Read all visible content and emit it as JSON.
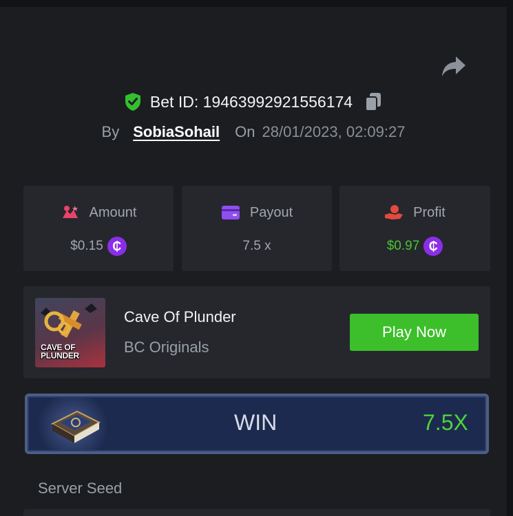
{
  "bet": {
    "label": "Bet ID:",
    "id": "19463992921556174",
    "by_label": "By",
    "user": "SobiaSohail",
    "on_label": "On",
    "datetime": "28/01/2023, 02:09:27"
  },
  "stats": {
    "amount": {
      "label": "Amount",
      "value": "$0.15"
    },
    "payout": {
      "label": "Payout",
      "value": "7.5 x"
    },
    "profit": {
      "label": "Profit",
      "value": "$0.97"
    }
  },
  "coin_symbol": "₵",
  "game": {
    "name": "Cave Of Plunder",
    "provider": "BC Originals",
    "thumb_title_line1": "CAVE OF",
    "thumb_title_line2": "PLUNDER",
    "play_label": "Play Now"
  },
  "result": {
    "label": "WIN",
    "multiplier": "7.5X"
  },
  "server_seed": {
    "label": "Server Seed"
  },
  "colors": {
    "background": "#1b1d21",
    "card": "#25272c",
    "accent_green": "#3cbf2a",
    "coin_purple": "#8c2ee8",
    "profit_green": "#49c433"
  },
  "icons": [
    "share-icon",
    "shield-check-icon",
    "copy-icon",
    "amount-icon",
    "payout-card-icon",
    "profit-hand-icon",
    "coin-icon",
    "book-icon"
  ]
}
